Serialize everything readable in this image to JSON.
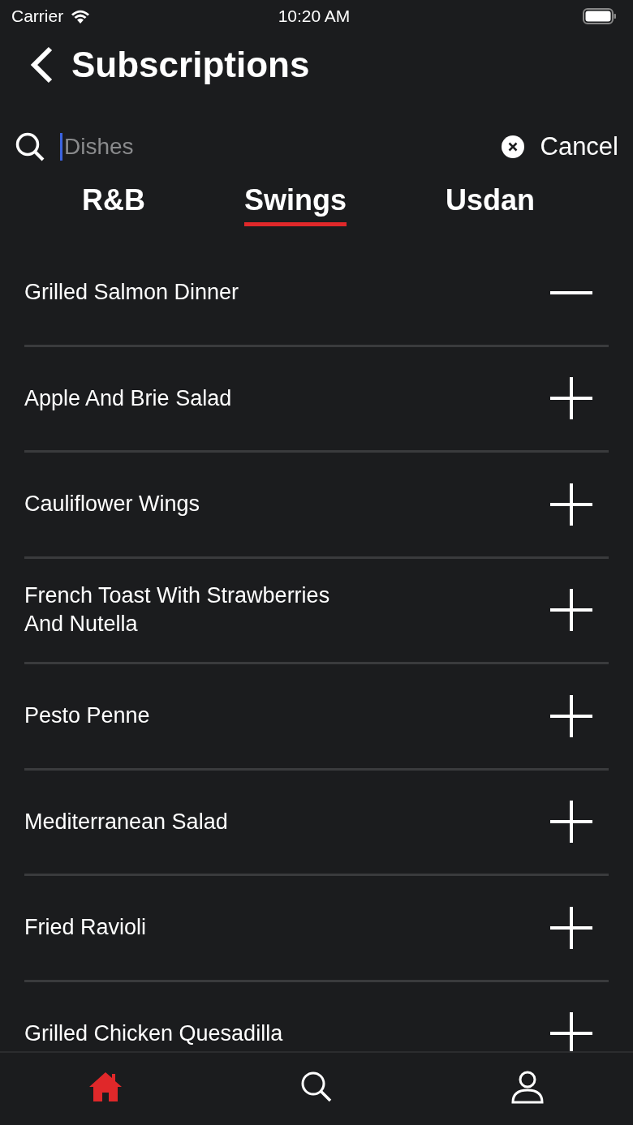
{
  "status_bar": {
    "carrier": "Carrier",
    "time": "10:20 AM"
  },
  "header": {
    "title": "Subscriptions"
  },
  "search": {
    "placeholder": "Dishes",
    "cancel": "Cancel"
  },
  "tabs": [
    {
      "label": "R&B",
      "selected": false
    },
    {
      "label": "Swings",
      "selected": true
    },
    {
      "label": "Usdan",
      "selected": false
    }
  ],
  "items": [
    {
      "name": "Grilled Salmon Dinner",
      "subscribed": true
    },
    {
      "name": "Apple And Brie Salad",
      "subscribed": false
    },
    {
      "name": "Cauliflower Wings",
      "subscribed": false
    },
    {
      "name": "French Toast With Strawberries And Nutella",
      "subscribed": false
    },
    {
      "name": "Pesto Penne",
      "subscribed": false
    },
    {
      "name": "Mediterranean Salad",
      "subscribed": false
    },
    {
      "name": "Fried Ravioli",
      "subscribed": false
    },
    {
      "name": "Grilled Chicken Quesadilla",
      "subscribed": false
    }
  ],
  "tab_bar": [
    {
      "kind": "home",
      "selected": true
    },
    {
      "kind": "search",
      "selected": false
    },
    {
      "kind": "profile",
      "selected": false
    }
  ]
}
